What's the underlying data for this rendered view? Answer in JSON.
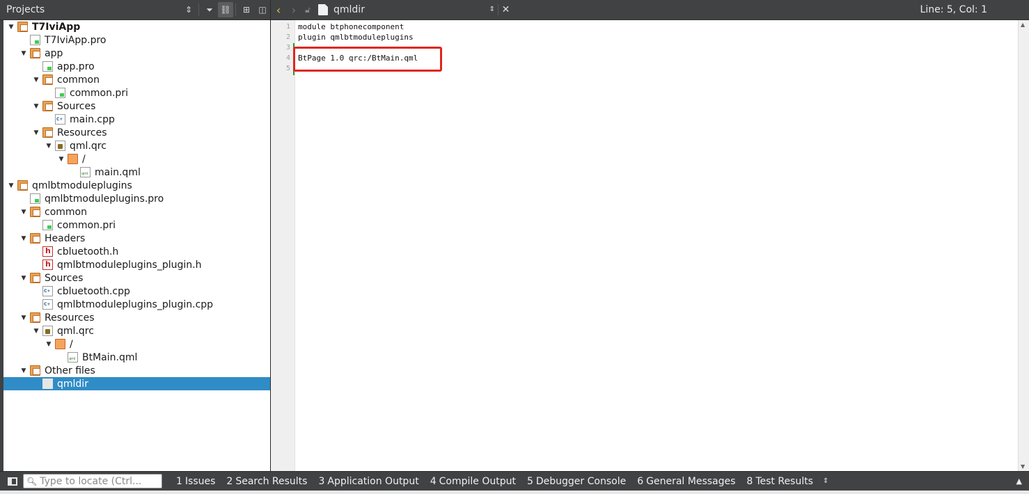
{
  "projects_pane": {
    "title": "Projects",
    "toolbar_icons": [
      "updown-icon",
      "filter-icon",
      "link-icon",
      "split-icon",
      "close-pane-icon"
    ]
  },
  "tree": [
    {
      "label": "T7IviApp",
      "level": 0,
      "expanded": true,
      "icon": "project-folder-icon",
      "bold": true
    },
    {
      "label": "T7IviApp.pro",
      "level": 1,
      "icon": "pro-file-icon"
    },
    {
      "label": "app",
      "level": 1,
      "expanded": true,
      "icon": "project-folder-icon"
    },
    {
      "label": "app.pro",
      "level": 2,
      "icon": "pro-file-icon"
    },
    {
      "label": "common",
      "level": 2,
      "expanded": true,
      "icon": "project-folder-icon"
    },
    {
      "label": "common.pri",
      "level": 3,
      "icon": "pro-file-icon"
    },
    {
      "label": "Sources",
      "level": 2,
      "expanded": true,
      "icon": "sources-folder-icon"
    },
    {
      "label": "main.cpp",
      "level": 3,
      "icon": "cpp-file-icon"
    },
    {
      "label": "Resources",
      "level": 2,
      "expanded": true,
      "icon": "resources-folder-icon"
    },
    {
      "label": "qml.qrc",
      "level": 3,
      "expanded": true,
      "icon": "qrc-file-icon"
    },
    {
      "label": "/",
      "level": 4,
      "expanded": true,
      "icon": "folder-icon"
    },
    {
      "label": "main.qml",
      "level": 5,
      "icon": "qml-file-icon"
    },
    {
      "label": "qmlbtmoduleplugins",
      "level": 0,
      "expanded": true,
      "icon": "project-folder-icon"
    },
    {
      "label": "qmlbtmoduleplugins.pro",
      "level": 1,
      "icon": "pro-file-icon"
    },
    {
      "label": "common",
      "level": 1,
      "expanded": true,
      "icon": "project-folder-icon"
    },
    {
      "label": "common.pri",
      "level": 2,
      "icon": "pro-file-icon"
    },
    {
      "label": "Headers",
      "level": 1,
      "expanded": true,
      "icon": "headers-folder-icon"
    },
    {
      "label": "cbluetooth.h",
      "level": 2,
      "icon": "header-file-icon"
    },
    {
      "label": "qmlbtmoduleplugins_plugin.h",
      "level": 2,
      "icon": "header-file-icon"
    },
    {
      "label": "Sources",
      "level": 1,
      "expanded": true,
      "icon": "sources-folder-icon"
    },
    {
      "label": "cbluetooth.cpp",
      "level": 2,
      "icon": "cpp-file-icon"
    },
    {
      "label": "qmlbtmoduleplugins_plugin.cpp",
      "level": 2,
      "icon": "cpp-file-icon"
    },
    {
      "label": "Resources",
      "level": 1,
      "expanded": true,
      "icon": "resources-folder-icon"
    },
    {
      "label": "qml.qrc",
      "level": 2,
      "expanded": true,
      "icon": "qrc-file-icon"
    },
    {
      "label": "/",
      "level": 3,
      "expanded": true,
      "icon": "folder-icon"
    },
    {
      "label": "BtMain.qml",
      "level": 4,
      "icon": "qml-file-icon"
    },
    {
      "label": "Other files",
      "level": 1,
      "expanded": true,
      "icon": "other-files-folder-icon"
    },
    {
      "label": "qmldir",
      "level": 2,
      "icon": "document-icon",
      "selected": true
    }
  ],
  "editor": {
    "open_document": "qmldir",
    "cursor_position": "Line: 5, Col: 1",
    "lines": [
      {
        "no": "1",
        "text": "module btphonecomponent"
      },
      {
        "no": "2",
        "text": "plugin qmlbtmoduleplugins"
      },
      {
        "no": "3",
        "text": ""
      },
      {
        "no": "4",
        "text": "BtPage 1.0 qrc:/BtMain.qml"
      },
      {
        "no": "5",
        "text": ""
      }
    ],
    "highlight_color": "#e0261e"
  },
  "statusbar": {
    "locator_placeholder": "Type to locate (Ctrl...",
    "panes": [
      {
        "num": "1",
        "label": "Issues"
      },
      {
        "num": "2",
        "label": "Search Results"
      },
      {
        "num": "3",
        "label": "Application Output"
      },
      {
        "num": "4",
        "label": "Compile Output"
      },
      {
        "num": "5",
        "label": "Debugger Console"
      },
      {
        "num": "6",
        "label": "General Messages"
      },
      {
        "num": "8",
        "label": "Test Results"
      }
    ]
  },
  "colors": {
    "chrome": "#404244",
    "selection": "#308cc6",
    "accent_back_arrow": "#f0c040"
  }
}
